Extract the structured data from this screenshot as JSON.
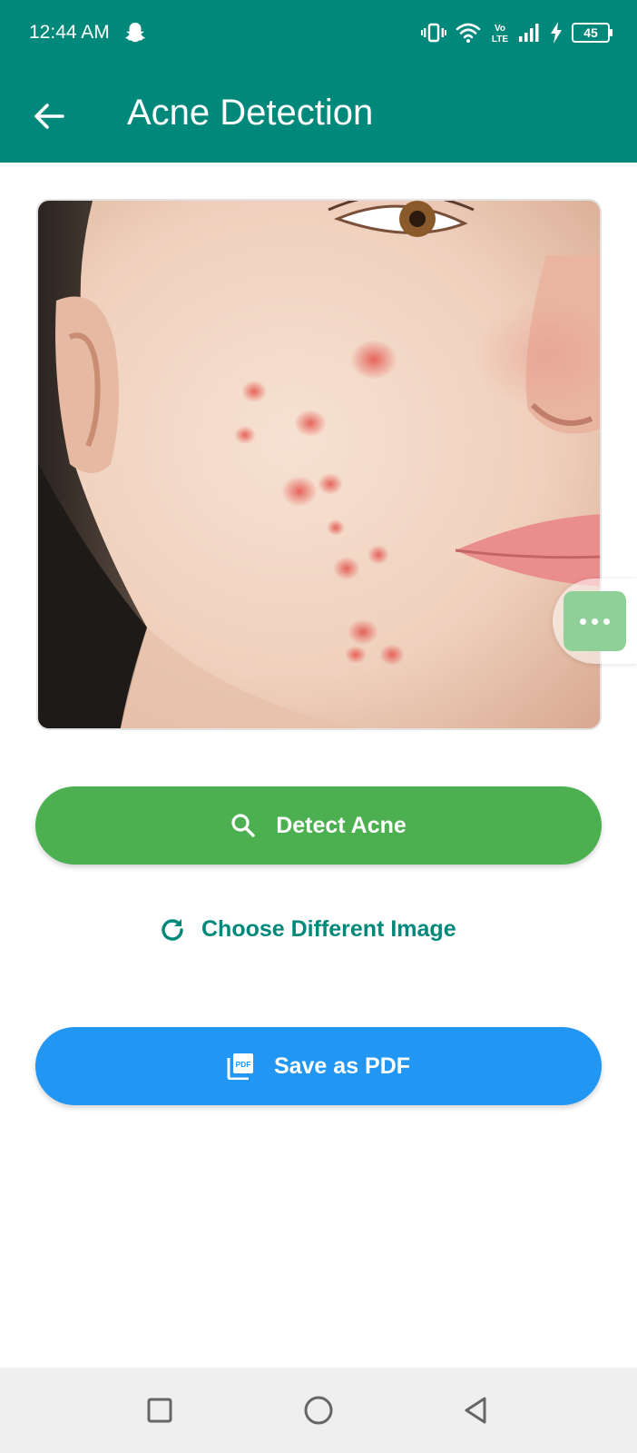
{
  "status_bar": {
    "time": "12:44 AM",
    "network_label": "Vo LTE",
    "battery_level": "45"
  },
  "toolbar": {
    "title": "Acne Detection",
    "back_icon": "arrow-left-icon"
  },
  "photo": {
    "description_icon": "face-photo",
    "overlay_menu_icon": "more-horizontal-icon"
  },
  "actions": {
    "detect_label": "Detect Acne",
    "detect_icon": "search-icon",
    "choose_label": "Choose Different Image",
    "choose_icon": "refresh-icon",
    "pdf_label": "Save as PDF",
    "pdf_icon": "pdf-file-icon"
  },
  "navigation": {
    "recents_icon": "square-icon",
    "home_icon": "circle-icon",
    "back_icon": "triangle-back-icon"
  },
  "colors": {
    "header": "#00897B",
    "detect_button": "#4CAF50",
    "pdf_button": "#2196F3",
    "link_text": "#00897B",
    "nav_bar": "#efefef"
  }
}
